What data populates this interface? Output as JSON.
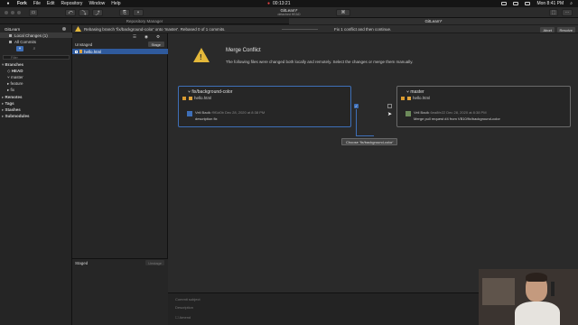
{
  "menubar": {
    "apple": "",
    "items": [
      "Fork",
      "File",
      "Edit",
      "Repository",
      "Window",
      "Help"
    ],
    "timer": "00:13:21",
    "clock": "Mon 8:41 PM"
  },
  "window": {
    "title": "GitLearn*",
    "subtitle": "detached HEAD"
  },
  "tabs": {
    "left": "Repository Manager",
    "active": "GitLearn*"
  },
  "notification": {
    "message": "Rebasing branch 'fix/background-color' onto 'master'. Rebased 0 of 1 commits.",
    "conflicts": "Fix 1 conflict and then continue.",
    "abort_label": "Abort",
    "resolve_label": "Resolve"
  },
  "sidebar": {
    "repo": "GitLearn",
    "local_changes": "Local Changes (1)",
    "all_commits": "All Commits",
    "filter_placeholder": "Filter",
    "groups": {
      "branches": "Branches",
      "remotes": "Remotes",
      "tags": "Tags",
      "stashes": "Stashes",
      "submodules": "Submodules"
    },
    "branches": [
      "HEAD",
      "master",
      "feature",
      "fix"
    ]
  },
  "files": {
    "unstaged_label": "Unstaged",
    "stage_label": "Stage",
    "file_name": "hello.html",
    "staged_label": "Staged",
    "unstage_label": "Unstage"
  },
  "conflict": {
    "title": "Merge Conflict",
    "description": "The following files were changed both locally and remotely. Select the changes or merge them manually.",
    "left": {
      "branch": "fix/background-color",
      "file": "hello.html",
      "author": "Veli Bacik",
      "hash": "f9f1d0b",
      "date": "Dec 28, 2020 at 8:38 PM",
      "message": "description fix"
    },
    "right": {
      "branch": "master",
      "file": "hello.html",
      "author": "Veli Bacik",
      "hash": "6ea8fe22",
      "date": "Dec 28, 2020 at 8:38 PM",
      "message": "Merge pull request #4 from VB10/fix/background-color"
    },
    "tooltip": "Choose 'fix/background-color'"
  },
  "commit": {
    "subject_placeholder": "Commit subject",
    "description_placeholder": "Description",
    "amend_label": "Amend"
  }
}
